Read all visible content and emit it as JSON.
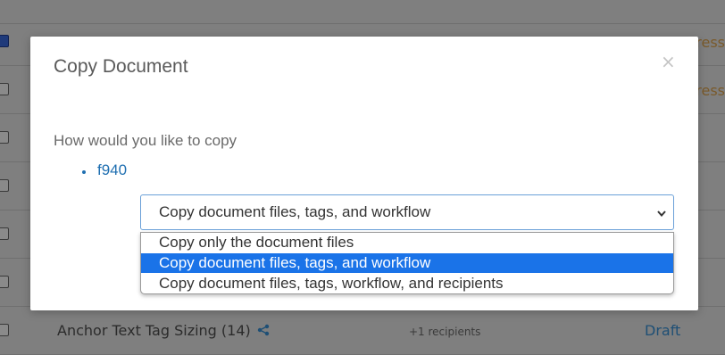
{
  "modal": {
    "title": "Copy Document",
    "close_label": "×",
    "prompt": "How would you like to copy",
    "document_name": "f940",
    "select_value": "Copy document files, tags, and workflow",
    "options": [
      {
        "label": "Copy only the document files",
        "selected": false
      },
      {
        "label": "Copy document files, tags, and workflow",
        "selected": true
      },
      {
        "label": "Copy document files, tags, workflow, and recipients",
        "selected": false
      }
    ]
  },
  "background": {
    "rows": [
      {
        "status": "ress",
        "checked": true
      },
      {
        "status": "ress",
        "checked": false
      }
    ],
    "bottom_row": {
      "name": "Anchor Text Tag Sizing (14)",
      "recipients": "+1 recipients",
      "status": "Draft"
    }
  },
  "colors": {
    "accent": "#1f6fb1",
    "selected_option": "#1a73e8",
    "overlay": "#7f7f7f"
  },
  "icons": {
    "close": "close-icon",
    "chevron": "chevron-down-icon",
    "share": "share-icon"
  }
}
